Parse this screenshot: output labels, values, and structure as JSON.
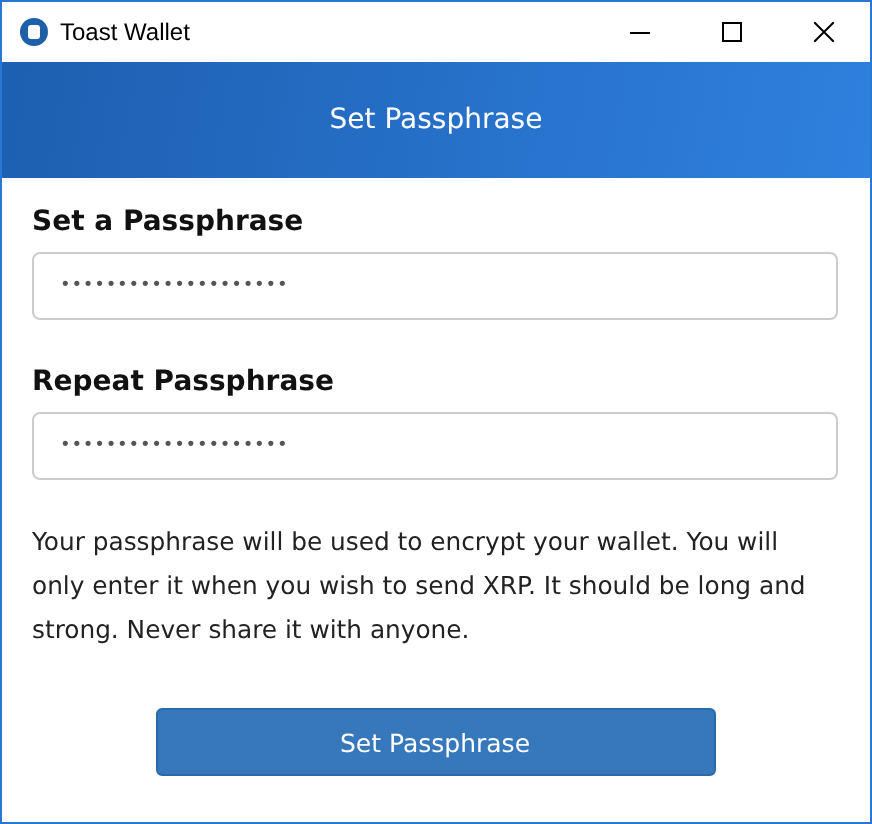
{
  "window": {
    "title": "Toast Wallet"
  },
  "header": {
    "title": "Set Passphrase"
  },
  "fields": [
    {
      "label": "Set a Passphrase",
      "value": "••••••••••••••••••••"
    },
    {
      "label": "Repeat Passphrase",
      "value": "••••••••••••••••••••"
    }
  ],
  "notice": "Your passphrase will be used to encrypt your wallet. You will only enter it when you wish to send XRP. It should be long and strong. Never share it with anyone.",
  "buttons": [
    {
      "label": "Set Passphrase"
    }
  ]
}
